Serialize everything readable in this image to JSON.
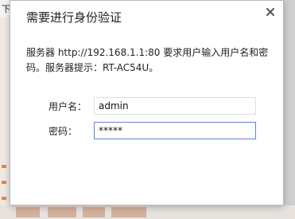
{
  "background": {
    "partial_char": "下"
  },
  "dialog": {
    "title": "需要进行身份验证",
    "close_icon": "close-x",
    "message": "服务器 http://192.168.1.1:80 要求用户输入用户名和密码。服务器提示：RT-AC54U。",
    "username": {
      "label": "用户名：",
      "value": "admin"
    },
    "password": {
      "label": "密码：",
      "value": "*****"
    }
  },
  "colors": {
    "password_focus_border": "#5b87d8",
    "title_text": "#222222"
  }
}
